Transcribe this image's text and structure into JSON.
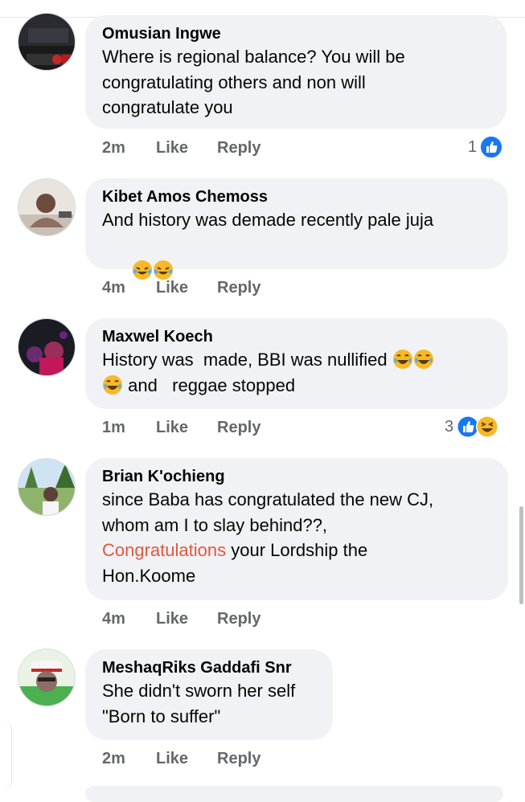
{
  "comments": [
    {
      "author": "Omusian Ingwe",
      "lines": [
        "Where is regional balance? You will be",
        "congratulating others and non will",
        "congratulate you"
      ],
      "time": "2m",
      "like": "Like",
      "reply": "Reply",
      "reaction_count": "1",
      "reactions": [
        "like"
      ],
      "avatar": "avatar-omusian"
    },
    {
      "author": "Kibet Amos Chemoss",
      "lines": [
        "And history was demade recently pale juja"
      ],
      "emoji_line": [
        "rolling-laughing-emoji",
        "rolling-laughing-emoji"
      ],
      "time": "4m",
      "like": "Like",
      "reply": "Reply",
      "avatar": "avatar-kibet"
    },
    {
      "author": "Maxwel Koech",
      "line1": "History was  made, BBI was nullified",
      "line2": " and   reggae stopped",
      "time": "1m",
      "like": "Like",
      "reply": "Reply",
      "reaction_count": "3",
      "reactions": [
        "like",
        "haha"
      ],
      "avatar": "avatar-maxwel"
    },
    {
      "author": "Brian K'ochieng",
      "lines": [
        "since Baba has congratulated the new CJ,",
        "whom am I to slay behind??,"
      ],
      "link_text": "Congratulations",
      "after_link": " your Lordship the",
      "last_line": "Hon.Koome",
      "time": "4m",
      "like": "Like",
      "reply": "Reply",
      "avatar": "avatar-brian"
    },
    {
      "author": "MeshaqRiks Gaddafi Snr",
      "lines": [
        "She didn't sworn her self",
        "\"Born to suffer\""
      ],
      "time": "2m",
      "like": "Like",
      "reply": "Reply",
      "avatar": "avatar-meshaq"
    }
  ],
  "colors": {
    "bubble": "#f0f2f5",
    "like_blue": "#1877f2",
    "link": "#e2583e",
    "meta": "#65676b"
  }
}
